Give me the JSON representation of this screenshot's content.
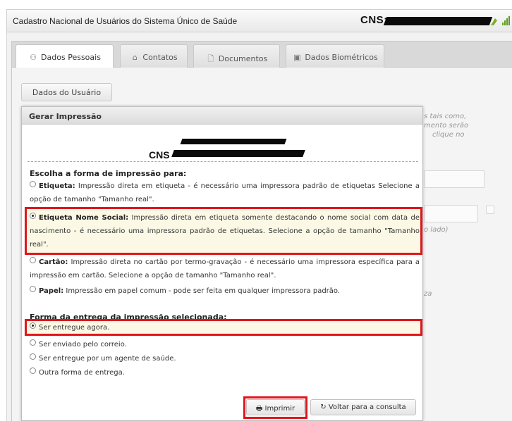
{
  "header": {
    "title": "Cadastro Nacional de Usuários do Sistema Único de Saúde",
    "cns_label": "CNS:"
  },
  "tabs": [
    {
      "label": "Dados Pessoais",
      "icon": "user-icon"
    },
    {
      "label": "Contatos",
      "icon": "home-icon"
    },
    {
      "label": "Documentos",
      "icon": "document-icon"
    },
    {
      "label": "Dados Biométricos",
      "icon": "fingerprint-icon"
    }
  ],
  "panel": {
    "user_button": "Dados do Usuário",
    "ghost_lines": [
      "s tais como,",
      "mento serão",
      "clique no",
      "o lado)",
      "za"
    ]
  },
  "dialog": {
    "title": "Gerar Impressão",
    "cns_label": "CNS",
    "print_section_title": "Escolha a forma de impressão para:",
    "print_options": [
      {
        "label": "Etiqueta:",
        "text": "Impressão direta em etiqueta - é necessário uma impressora padrão de etiquetas Selecione a opção de tamanho \"Tamanho real\".",
        "selected": false
      },
      {
        "label": "Etiqueta Nome Social:",
        "text": "Impressão direta em etiqueta somente destacando o nome social com data de nascimento - é necessário uma impressora padrão de etiquetas. Selecione a opção de tamanho \"Tamanho real\".",
        "selected": true
      },
      {
        "label": "Cartão:",
        "text": "Impressão direta no cartão por termo-gravação - é necessário uma impressora específica para a impressão em cartão. Selecione a opção de tamanho \"Tamanho real\".",
        "selected": false
      },
      {
        "label": "Papel:",
        "text": "Impressão em papel comum - pode ser feita em qualquer impressora padrão.",
        "selected": false
      }
    ],
    "delivery_section_title": "Forma da entrega da impressão selecionada:",
    "delivery_options": [
      {
        "text": "Ser entregue agora.",
        "selected": true
      },
      {
        "text": "Ser enviado pelo correio.",
        "selected": false
      },
      {
        "text": "Ser entregue por um agente de saúde.",
        "selected": false
      },
      {
        "text": "Outra forma de entrega.",
        "selected": false
      }
    ],
    "print_button": "Imprimir",
    "back_button": "Voltar para a consulta"
  },
  "colors": {
    "highlight": "#e0161b",
    "selected_row_bg": "#fbf9e6"
  }
}
